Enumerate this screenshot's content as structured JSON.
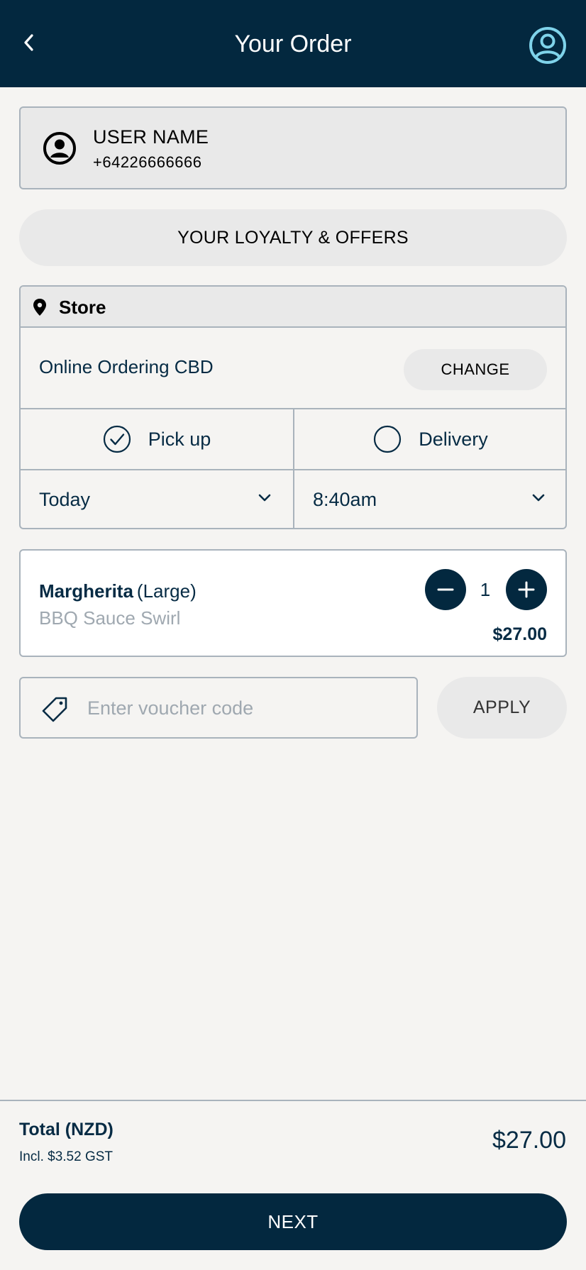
{
  "header": {
    "title": "Your Order",
    "back_icon": "chevron-left-icon",
    "profile_icon": "user-circle-icon"
  },
  "user": {
    "name": "USER NAME",
    "phone": "+64226666666"
  },
  "loyalty": {
    "label": "YOUR LOYALTY & OFFERS"
  },
  "store": {
    "section_label": "Store",
    "name": "Online Ordering CBD",
    "change_label": "CHANGE",
    "modes": [
      {
        "label": "Pick up",
        "selected": true
      },
      {
        "label": "Delivery",
        "selected": false
      }
    ],
    "day": "Today",
    "time": "8:40am"
  },
  "cart": {
    "items": [
      {
        "name": "Margherita",
        "size": "(Large)",
        "modifier": "BBQ Sauce Swirl",
        "quantity": "1",
        "price": "$27.00"
      }
    ]
  },
  "voucher": {
    "placeholder": "Enter voucher code",
    "apply_label": "APPLY"
  },
  "summary": {
    "total_label": "Total (NZD)",
    "gst_text": "Incl. $3.52 GST",
    "total_value": "$27.00",
    "next_label": "NEXT"
  },
  "colors": {
    "primary": "#03283f",
    "background": "#f5f4f2",
    "surface": "#e9e9e9",
    "border": "#a9b3bc",
    "accent_icon": "#7fd3ea",
    "muted_text": "#9fa8b0"
  }
}
